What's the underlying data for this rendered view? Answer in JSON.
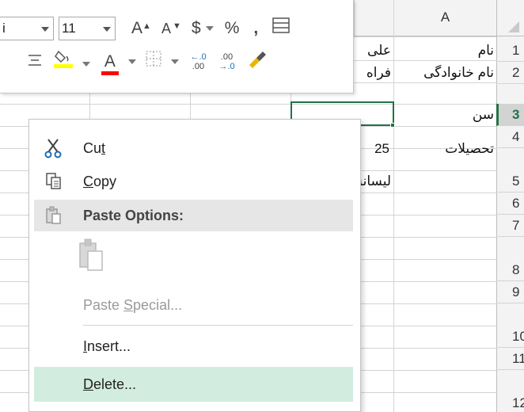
{
  "sheet": {
    "column_header_label": "A",
    "row_numbers": [
      "1",
      "2",
      "3",
      "4",
      "5",
      "6",
      "7",
      "8",
      "9",
      "10",
      "11",
      "12"
    ],
    "active_row_number": "3",
    "cells": {
      "a1": "نام",
      "b1": "علی",
      "a2": "نام خانوادگی",
      "b2": "فراه",
      "a3": "سن",
      "a4": "تحصیلات",
      "b4": "25",
      "b5": "لیسانس"
    }
  },
  "mini_toolbar": {
    "font_name_partial": "i",
    "font_size": "11",
    "grow_font_glyph": "A",
    "shrink_font_glyph": "A",
    "currency_glyph": "$",
    "percent_glyph": "%",
    "comma_glyph": ",",
    "font_color_glyph": "A",
    "increase_decimal_top": ".0",
    "increase_decimal_bottom": ".00",
    "decrease_decimal_top": ".00",
    "decrease_decimal_bottom": ".0",
    "fill_color": "#ffff00",
    "font_color": "#ff0000"
  },
  "context_menu": {
    "cut_label_pre": "Cu",
    "cut_label_ul": "t",
    "copy_label_ul": "C",
    "copy_label_post": "opy",
    "paste_options_label": "Paste Options:",
    "paste_special_pre": "Paste ",
    "paste_special_ul": "S",
    "paste_special_post": "pecial...",
    "insert_label_ul": "I",
    "insert_label_post": "nsert...",
    "delete_label_ul": "D",
    "delete_label_post": "elete..."
  },
  "colors": {
    "accent_green": "#217346",
    "hover_green": "#d2ede0",
    "header_gray": "#e6e6e6"
  }
}
